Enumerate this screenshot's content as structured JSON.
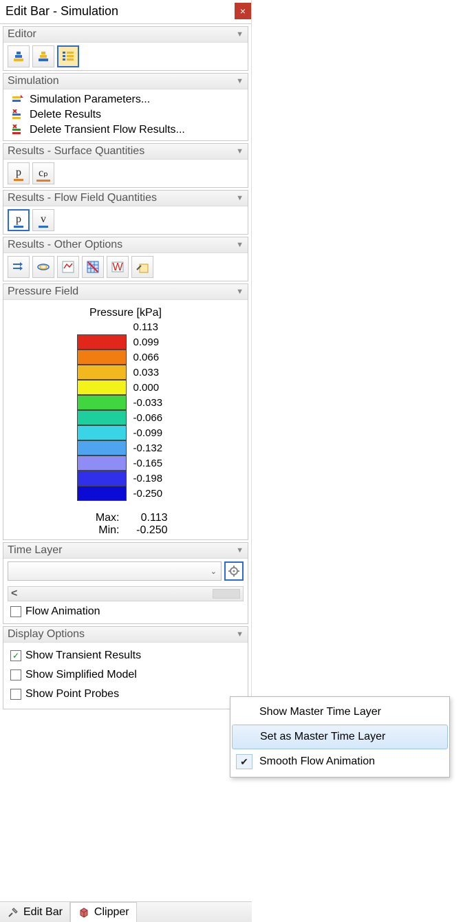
{
  "window": {
    "title": "Edit Bar - Simulation",
    "close_label": "×"
  },
  "editor": {
    "header": "Editor"
  },
  "simulation": {
    "header": "Simulation",
    "items": [
      {
        "label": "Simulation Parameters..."
      },
      {
        "label": "Delete Results"
      },
      {
        "label": "Delete Transient Flow Results..."
      }
    ]
  },
  "results_surface": {
    "header": "Results - Surface Quantities",
    "buttons": [
      "p",
      "cₚ"
    ]
  },
  "results_flowfield": {
    "header": "Results - Flow Field Quantities",
    "buttons": [
      "p",
      "v"
    ]
  },
  "results_other": {
    "header": "Results - Other Options"
  },
  "pressure_field": {
    "header": "Pressure Field",
    "title": "Pressure [kPa]",
    "scale": [
      {
        "color": "#b10e0e",
        "label": "0.113"
      },
      {
        "color": "#e1261c",
        "label": "0.099"
      },
      {
        "color": "#f17d11",
        "label": "0.066"
      },
      {
        "color": "#f2b91e",
        "label": "0.033"
      },
      {
        "color": "#f3f31a",
        "label": "0.000"
      },
      {
        "color": "#3fd63f",
        "label": "-0.033"
      },
      {
        "color": "#1ecf9d",
        "label": "-0.066"
      },
      {
        "color": "#3ad4e7",
        "label": "-0.099"
      },
      {
        "color": "#4ea4ef",
        "label": "-0.132"
      },
      {
        "color": "#8d8df5",
        "label": "-0.165"
      },
      {
        "color": "#3030ea",
        "label": "-0.198"
      },
      {
        "color": "#0b0bd6",
        "label": "-0.250"
      }
    ],
    "max_label": "Max:",
    "max_value": "0.113",
    "min_label": "Min:",
    "min_value": "-0.250"
  },
  "time_layer": {
    "header": "Time Layer",
    "flow_animation_label": "Flow Animation",
    "flow_animation_checked": false
  },
  "display_options": {
    "header": "Display Options",
    "items": [
      {
        "label": "Show Transient Results",
        "checked": true
      },
      {
        "label": "Show Simplified Model",
        "checked": false
      },
      {
        "label": "Show Point Probes",
        "checked": false
      }
    ]
  },
  "context_menu": {
    "items": [
      {
        "label": "Show Master Time Layer",
        "hovered": false,
        "checked": false
      },
      {
        "label": "Set as Master Time Layer",
        "hovered": true,
        "checked": false
      },
      {
        "label": "Smooth Flow Animation",
        "hovered": false,
        "checked": true
      }
    ]
  },
  "tabs": {
    "items": [
      {
        "label": "Edit Bar",
        "active": false
      },
      {
        "label": "Clipper",
        "active": true
      }
    ]
  }
}
